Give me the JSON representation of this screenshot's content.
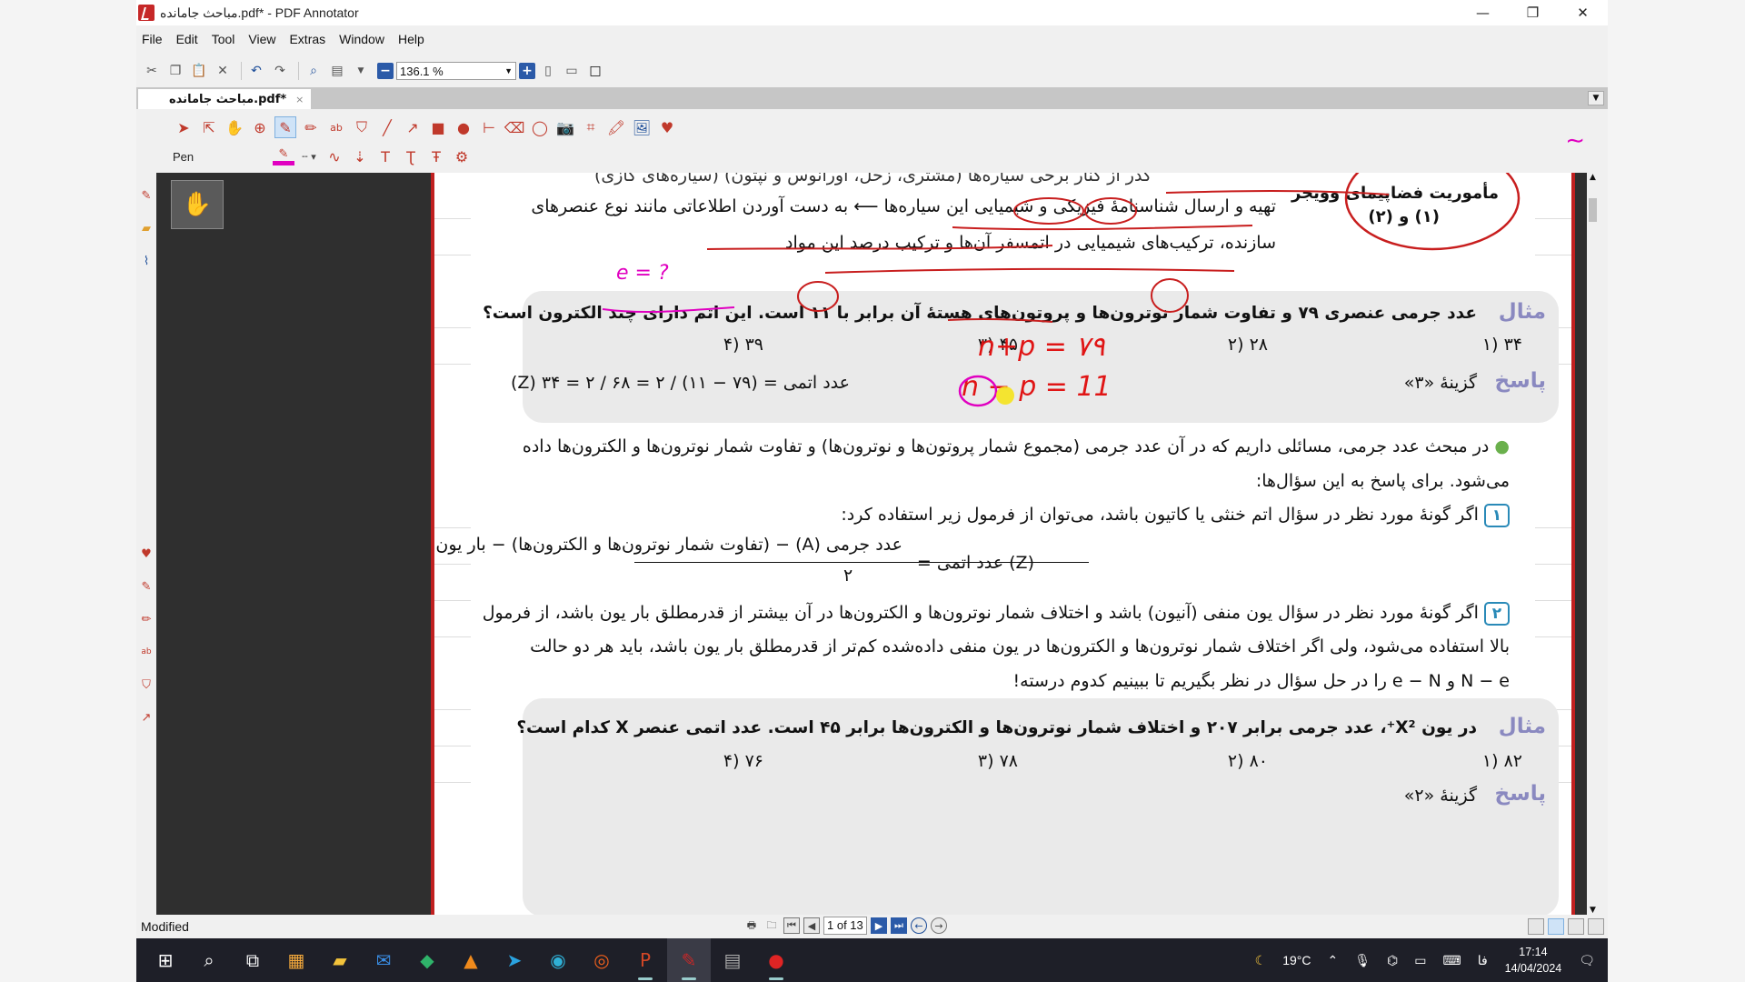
{
  "window": {
    "title": "مباحث جامانده.pdf* - PDF Annotator",
    "minimize": "—",
    "maximize": "❐",
    "close": "✕"
  },
  "menu": [
    "File",
    "Edit",
    "Tool",
    "View",
    "Extras",
    "Window",
    "Help"
  ],
  "toolbar": {
    "zoom_value": "136.1 %",
    "zoom_minus": "−",
    "zoom_plus": "+"
  },
  "tab": {
    "label": "مباحث جامانده.pdf*",
    "close": "×"
  },
  "annotation_toolbar": {
    "current_tool_label": "Pen",
    "pen_color": "#e000c0"
  },
  "document": {
    "top_lines": [
      "گذر از کنار برخی سیاره‌ها (مشتری، زحل، اورانوس و نپتون) (سیاره‌های گازی)",
      "تهیه و ارسال شناسنامهٔ فیزیکی و شیمیایی این سیاره‌ها ⟵ به دست آوردن اطلاعاتی مانند نوع عنصرهای",
      "سازنده، ترکیب‌های شیمیایی در اتمسفر آن‌ها و ترکیب درصد این مواد"
    ],
    "mission_label": "مأموریت فضاپیمای وویجر",
    "mission_sub": "(۱) و (۲)",
    "example1": {
      "label": "مثال",
      "question": "عدد جرمی عنصری ۷۹ و تفاوت شمار نوترون‌ها و پروتون‌های هستهٔ آن برابر با ۱۱ است. این اتم دارای چند الکترون است؟",
      "options": [
        "۳۴ (۱",
        "۲۸ (۲",
        "۴۵ (۳",
        "۳۹ (۴"
      ],
      "answer_label": "پاسخ",
      "answer_choice": "گزینهٔ «۳»",
      "answer_formula": "(Z) عدد اتمی = (۷۹ − ۱۱) / ۲ = ۶۸ / ۲ = ۳۴"
    },
    "handwriting": {
      "e_note": "e = ?",
      "eq1": "n+p = ۷۹",
      "eq2": "n − p = 11"
    },
    "paragraph": [
      "در مبحث عدد جرمی، مسائلی داریم که در آن عدد جرمی (مجموع شمار پروتون‌ها و نوترون‌ها) و تفاوت شمار نوترون‌ها و الکترون‌ها داده",
      "می‌شود. برای پاسخ به این سؤال‌ها:"
    ],
    "item1": {
      "badge": "۱",
      "text": "اگر گونهٔ مورد نظر در سؤال اتم خنثی یا کاتیون باشد، می‌توان از فرمول زیر استفاده کرد:"
    },
    "formula": {
      "lhs": "(Z) عدد اتمی =",
      "numerator": "عدد جرمی (A) − (تفاوت شمار نوترون‌ها و الکترون‌ها) − بار یون با علامت",
      "denominator": "۲"
    },
    "item2": {
      "badge": "۲",
      "lines": [
        "اگر گونهٔ مورد نظر در سؤال یون منفی (آنیون) باشد و اختلاف شمار نوترون‌ها و الکترون‌ها در آن بیشتر از قدرمطلق بار یون باشد، از فرمول",
        "بالا استفاده می‌شود، ولی اگر اختلاف شمار نوترون‌ها و الکترون‌ها در یون منفی داده‌شده کم‌تر از قدرمطلق بار یون باشد، باید هر دو حالت",
        "N − e و e − N را در حل سؤال در نظر بگیریم تا ببینیم کدوم درسته!"
      ]
    },
    "example2": {
      "label": "مثال",
      "question": "در یون X²⁺، عدد جرمی برابر ۲۰۷ و اختلاف شمار نوترون‌ها و الکترون‌ها برابر ۴۵ است. عدد اتمی عنصر X کدام است؟",
      "options": [
        "۸۲ (۱",
        "۸۰ (۲",
        "۷۸ (۳",
        "۷۶ (۴"
      ],
      "answer_label": "پاسخ",
      "answer_choice": "گزینهٔ «۲»"
    }
  },
  "statusbar": {
    "status": "Modified",
    "page_indicator": "1 of 13"
  },
  "taskbar": {
    "weather": "19°C",
    "language": "فا",
    "time": "17:14",
    "date": "14/04/2024"
  }
}
